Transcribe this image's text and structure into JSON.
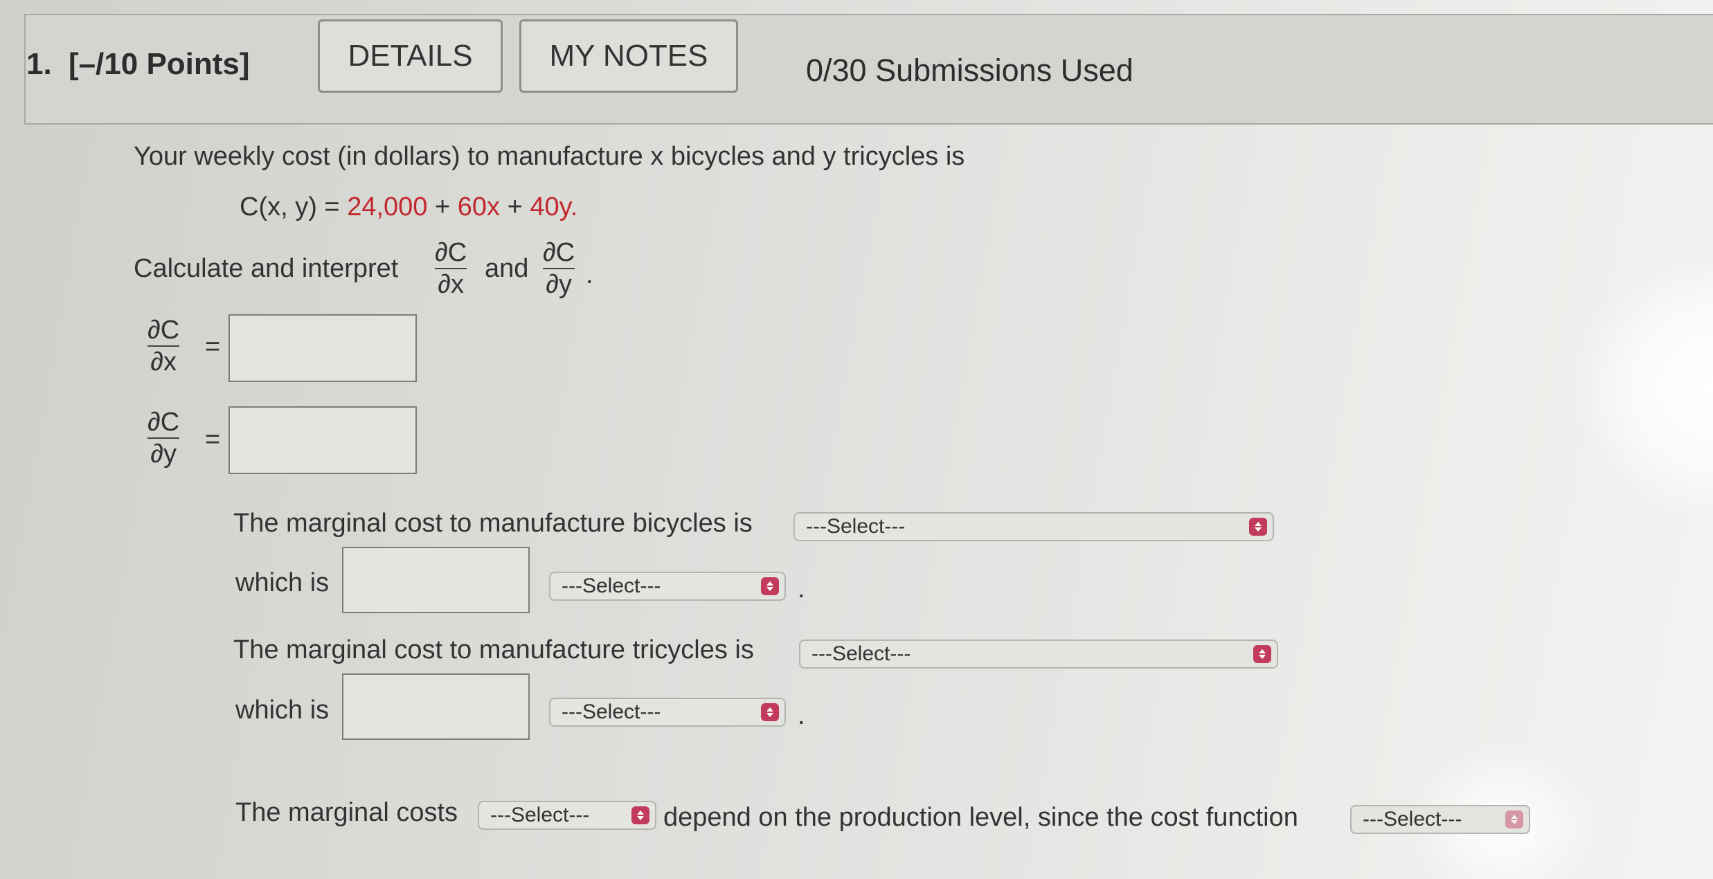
{
  "header": {
    "question_number": "1.",
    "points": "[–/10 Points]",
    "details_label": "DETAILS",
    "my_notes_label": "MY NOTES",
    "submissions": "0/30 Submissions Used"
  },
  "problem": {
    "intro": "Your weekly cost (in dollars) to manufacture x bicycles and y tricycles is",
    "formula_lhs": "C(x, y) =",
    "formula_const": "24,000",
    "formula_plus1": "+",
    "formula_coef_x": "60x",
    "formula_plus2": "+",
    "formula_coef_y": "40y.",
    "calc_prefix": "Calculate and interpret",
    "calc_and": "and",
    "partial_num": "∂C",
    "partial_dx": "∂x",
    "partial_dy": "∂y",
    "period": ".",
    "equals": "="
  },
  "answers": {
    "dc_dx_value": "",
    "dc_dy_value": "",
    "bicycles_prefix": "The marginal cost to manufacture bicycles is",
    "bicycles_select": "---Select---",
    "which_is_1": "which is",
    "which_is_1_value": "",
    "which_is_1_select": "---Select---",
    "tricycles_prefix": "The marginal cost to manufacture tricycles is",
    "tricycles_select": "---Select---",
    "which_is_2": "which is",
    "which_is_2_value": "",
    "which_is_2_select": "---Select---",
    "marginal_costs_prefix": "The marginal costs",
    "marginal_costs_select": "---Select---",
    "marginal_costs_middle": "depend on the production level, since the cost function",
    "cost_function_select": "---Select---"
  },
  "colors": {
    "accent_red": "#c2282f",
    "select_arrow": "#c33b5c"
  }
}
